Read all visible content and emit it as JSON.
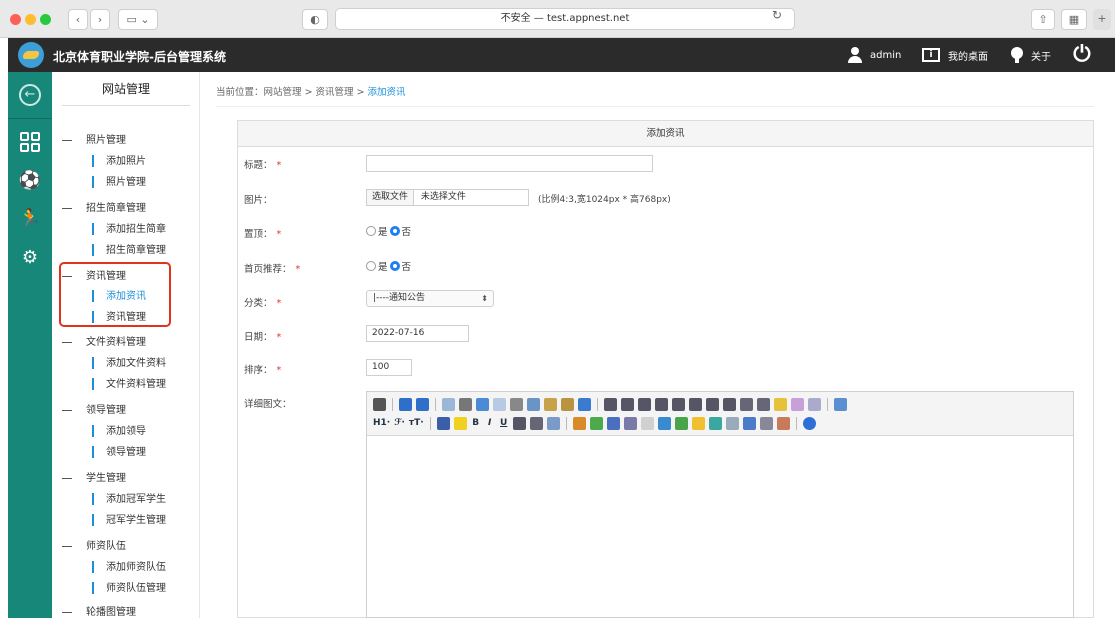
{
  "browser": {
    "address": "不安全 — test.appnest.net"
  },
  "header": {
    "title": "北京体育职业学院-后台管理系统",
    "user": "admin",
    "desktop": "我的桌面",
    "about": "关于"
  },
  "sidebar": {
    "title": "网站管理",
    "groups": [
      {
        "label": "照片管理",
        "items": [
          "添加照片",
          "照片管理"
        ]
      },
      {
        "label": "招生简章管理",
        "items": [
          "添加招生简章",
          "招生简章管理"
        ]
      },
      {
        "label": "资讯管理",
        "items": [
          "添加资讯",
          "资讯管理"
        ]
      },
      {
        "label": "文件资料管理",
        "items": [
          "添加文件资料",
          "文件资料管理"
        ]
      },
      {
        "label": "领导管理",
        "items": [
          "添加领导",
          "领导管理"
        ]
      },
      {
        "label": "学生管理",
        "items": [
          "添加冠军学生",
          "冠军学生管理"
        ]
      },
      {
        "label": "师资队伍",
        "items": [
          "添加师资队伍",
          "师资队伍管理"
        ]
      },
      {
        "label": "轮播图管理",
        "items": []
      }
    ]
  },
  "breadcrumb": {
    "prefix": "当前位置：网站管理 > 资讯管理 > ",
    "current": "添加资讯"
  },
  "form": {
    "title": "添加资讯",
    "title_label": "标题：",
    "title_value": "",
    "image_label": "图片：",
    "file_button": "选取文件",
    "file_status": "未选择文件",
    "image_hint": "(比例4:3,宽1024px * 高768px)",
    "top_label": "置顶：",
    "home_label": "首页推荐：",
    "yes": "是",
    "no": "否",
    "category_label": "分类：",
    "category_value": "|----通知公告",
    "date_label": "日期：",
    "date_value": "2022-07-16",
    "sort_label": "排序：",
    "sort_value": "100",
    "content_label": "详细图文：",
    "required_mark": "*"
  },
  "editor": {
    "heading_button": "H1·",
    "font_button": "ℱ·",
    "size_button": "тT·"
  }
}
